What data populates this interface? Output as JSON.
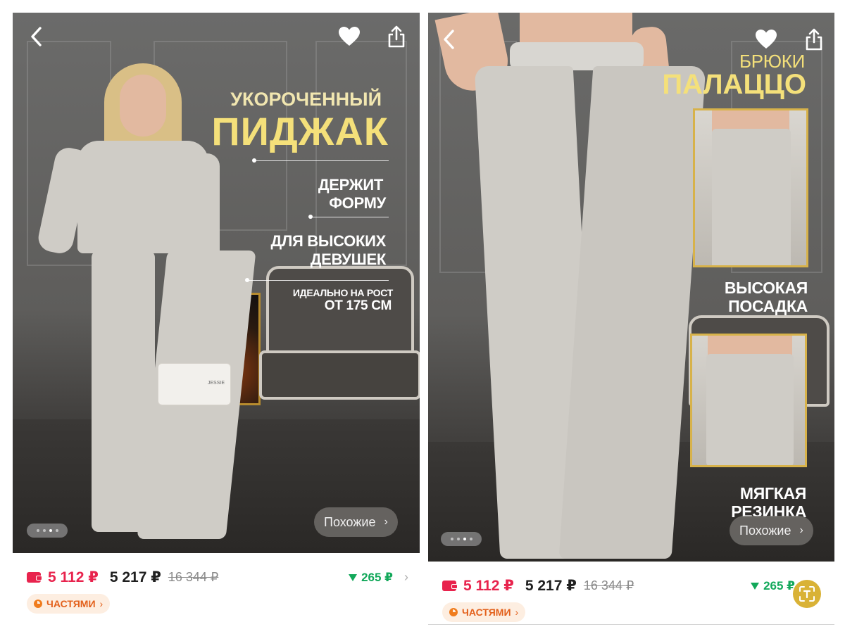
{
  "left": {
    "overlay": {
      "title_line1": "УКОРОЧЕННЫЙ",
      "title_line2": "ПИДЖАК",
      "feature1_line1": "ДЕРЖИТ",
      "feature1_line2": "ФОРМУ",
      "feature2_line1": "ДЛЯ ВЫСОКИХ",
      "feature2_line2": "ДЕВУШЕК",
      "feature3_line1": "ИДЕАЛЬНО НА РОСТ",
      "feature3_line2": "ОТ 175 СМ",
      "bag_logo": "JESSIE"
    },
    "similar_label": "Похожие",
    "pager_active_index": 2,
    "pager_count": 4
  },
  "right": {
    "overlay": {
      "title_line1": "БРЮКИ",
      "title_line2": "ПАЛАЦЦО",
      "feature1_line1": "ВЫСОКАЯ",
      "feature1_line2": "ПОСАДКА",
      "feature2_line1": "МЯГКАЯ",
      "feature2_line2": "РЕЗИНКА"
    },
    "similar_label": "Похожие",
    "pager_active_index": 2,
    "pager_count": 4
  },
  "price": {
    "card_price": "5 112 ₽",
    "price": "5 217 ₽",
    "old_price": "16 344 ₽",
    "discount": "265 ₽"
  },
  "installments_label": "ЧАСТЯМИ",
  "icons": {
    "back": "chevron-left-icon",
    "favorite": "heart-icon",
    "share": "share-icon",
    "wallet": "wallet-icon",
    "installments": "pie-icon",
    "scan": "scan-text-icon"
  },
  "colors": {
    "price_red": "#e8234d",
    "discount_green": "#12a85a",
    "gold_text": "#f4e07a",
    "installments_orange": "#e3601b"
  }
}
